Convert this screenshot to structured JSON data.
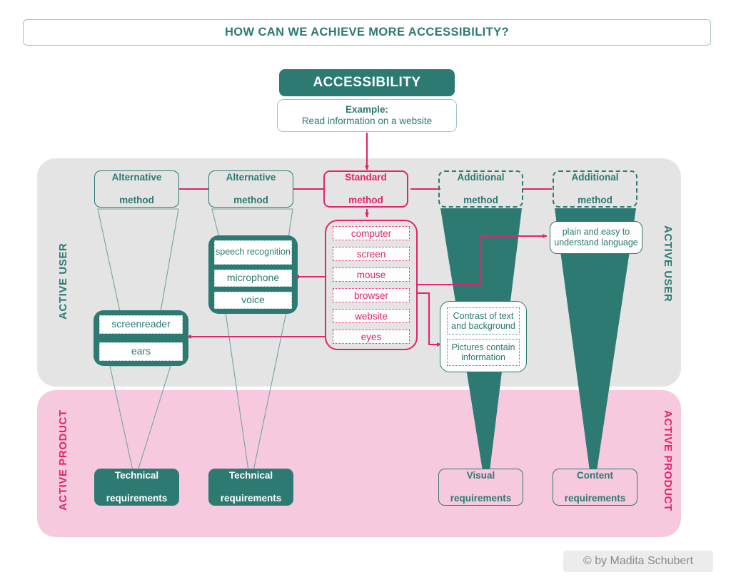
{
  "title": {
    "text": "HOW CAN WE ACHIEVE MORE ACCESSIBILITY?"
  },
  "header": {
    "accessibility_label": "ACCESSIBILITY",
    "example_title": "Example:",
    "example_text": "Read information on a website"
  },
  "bands": {
    "active_user_left": "ACTIVE USER",
    "active_user_right": "ACTIVE USER",
    "active_product_left": "ACTIVE PRODUCT",
    "active_product_right": "ACTIVE PRODUCT"
  },
  "methods": [
    {
      "id": "alt-1",
      "line1": "Alternative",
      "line2": "method",
      "kind": "alternative"
    },
    {
      "id": "alt-2",
      "line1": "Alternative",
      "line2": "method",
      "kind": "alternative"
    },
    {
      "id": "std",
      "line1": "Standard",
      "line2": "method",
      "kind": "standard"
    },
    {
      "id": "add-1",
      "line1": "Additional",
      "line2": "method",
      "kind": "additional"
    },
    {
      "id": "add-2",
      "line1": "Additional",
      "line2": "method",
      "kind": "additional"
    }
  ],
  "standard_items": [
    "computer",
    "screen",
    "mouse",
    "browser",
    "website",
    "eyes"
  ],
  "speech_group": {
    "items": [
      "speech recognition",
      "microphone",
      "voice"
    ]
  },
  "screenreader_group": {
    "items": [
      "screenreader",
      "ears"
    ]
  },
  "visual_group": {
    "items": [
      "Contrast of text and background",
      "Pictures contain information"
    ]
  },
  "content_group": {
    "text": "plain and easy to understand language"
  },
  "requirements": [
    {
      "id": "tech-1",
      "line1": "Technical",
      "line2": "requirements",
      "style": "filled"
    },
    {
      "id": "tech-2",
      "line1": "Technical",
      "line2": "requirements",
      "style": "filled"
    },
    {
      "id": "visual",
      "line1": "Visual",
      "line2": "requirements",
      "style": "outline"
    },
    {
      "id": "content",
      "line1": "Content",
      "line2": "requirements",
      "style": "outline"
    }
  ],
  "credit": {
    "text": "© by Madita Schubert"
  },
  "colors": {
    "teal": "#2c7a72",
    "pink": "#e2246c",
    "band_user": "#e4e4e4",
    "band_product": "#f7c9de",
    "teal_light": "#9fc3c3"
  }
}
